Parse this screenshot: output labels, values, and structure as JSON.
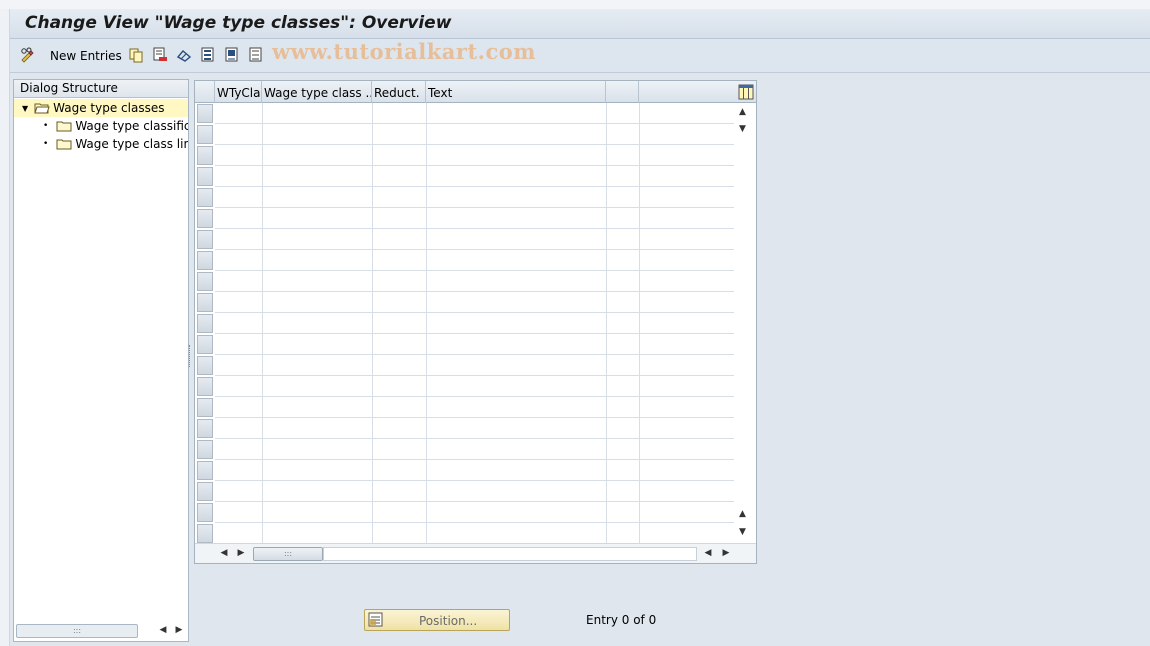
{
  "window": {
    "title": "Change View \"Wage type classes\": Overview"
  },
  "toolbar": {
    "new_entries_label": "New Entries",
    "watermark": "www.tutorialkart.com",
    "icons": [
      "glasses-pencil-icon",
      "copy-icon",
      "delete-icon",
      "undo-icon",
      "select-all-icon",
      "select-block-icon",
      "deselect-all-icon"
    ]
  },
  "dialog_structure": {
    "header": "Dialog Structure",
    "items": [
      {
        "label": "Wage type classes",
        "selected": true,
        "expanded": true
      },
      {
        "label": "Wage type classificat"
      },
      {
        "label": "Wage type class limit"
      }
    ]
  },
  "table": {
    "columns": [
      {
        "label": "WTyCla"
      },
      {
        "label": "Wage type class ..."
      },
      {
        "label": "Reduct."
      },
      {
        "label": "Text"
      },
      {
        "label": ""
      },
      {
        "label": ""
      }
    ],
    "row_count": 21
  },
  "footer": {
    "position_button_label": "Position...",
    "entry_status": "Entry 0 of 0"
  }
}
